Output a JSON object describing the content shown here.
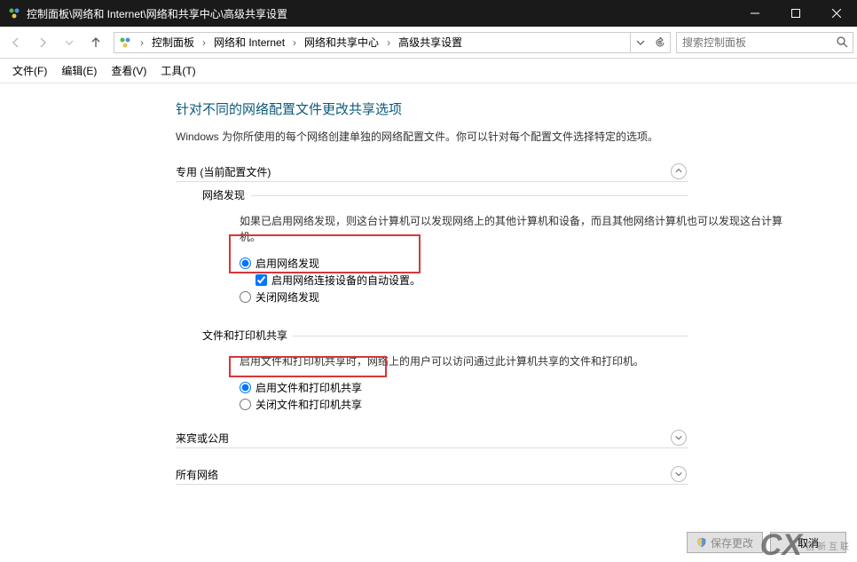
{
  "titlebar": {
    "text": "控制面板\\网络和 Internet\\网络和共享中心\\高级共享设置"
  },
  "breadcrumb": {
    "items": [
      "控制面板",
      "网络和 Internet",
      "网络和共享中心",
      "高级共享设置"
    ]
  },
  "search": {
    "placeholder": "搜索控制面板"
  },
  "menubar": {
    "file": "文件(F)",
    "edit": "编辑(E)",
    "view": "查看(V)",
    "tools": "工具(T)"
  },
  "main": {
    "heading": "针对不同的网络配置文件更改共享选项",
    "description": "Windows 为你所使用的每个网络创建单独的网络配置文件。你可以针对每个配置文件选择特定的选项。",
    "private_profile": {
      "label": "专用 (当前配置文件)",
      "discovery": {
        "title": "网络发现",
        "desc": "如果已启用网络发现，则这台计算机可以发现网络上的其他计算机和设备，而且其他网络计算机也可以发现这台计算机。",
        "on": "启用网络发现",
        "autosetup": "启用网络连接设备的自动设置。",
        "off": "关闭网络发现"
      },
      "filesharing": {
        "title": "文件和打印机共享",
        "desc": "启用文件和打印机共享时，网络上的用户可以访问通过此计算机共享的文件和打印机。",
        "on": "启用文件和打印机共享",
        "off": "关闭文件和打印机共享"
      }
    },
    "guest_profile": {
      "label": "来宾或公用"
    },
    "all_profile": {
      "label": "所有网络"
    }
  },
  "buttons": {
    "save": "保存更改",
    "cancel": "取消"
  },
  "watermark": {
    "logo": "CX",
    "text": "创新互联"
  }
}
